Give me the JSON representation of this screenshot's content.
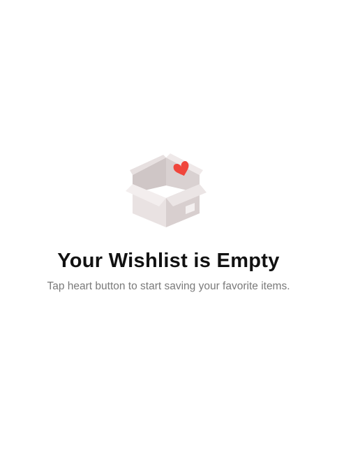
{
  "empty_state": {
    "illustration_icon": "open-box-with-heart-icon",
    "title": "Your Wishlist is Empty",
    "message": "Tap heart button to start saving your favorite items."
  },
  "colors": {
    "background": "#ffffff",
    "title": "#111111",
    "message": "#7a7a7a",
    "heart": "#f0463c",
    "box": "#ebe4e4"
  }
}
